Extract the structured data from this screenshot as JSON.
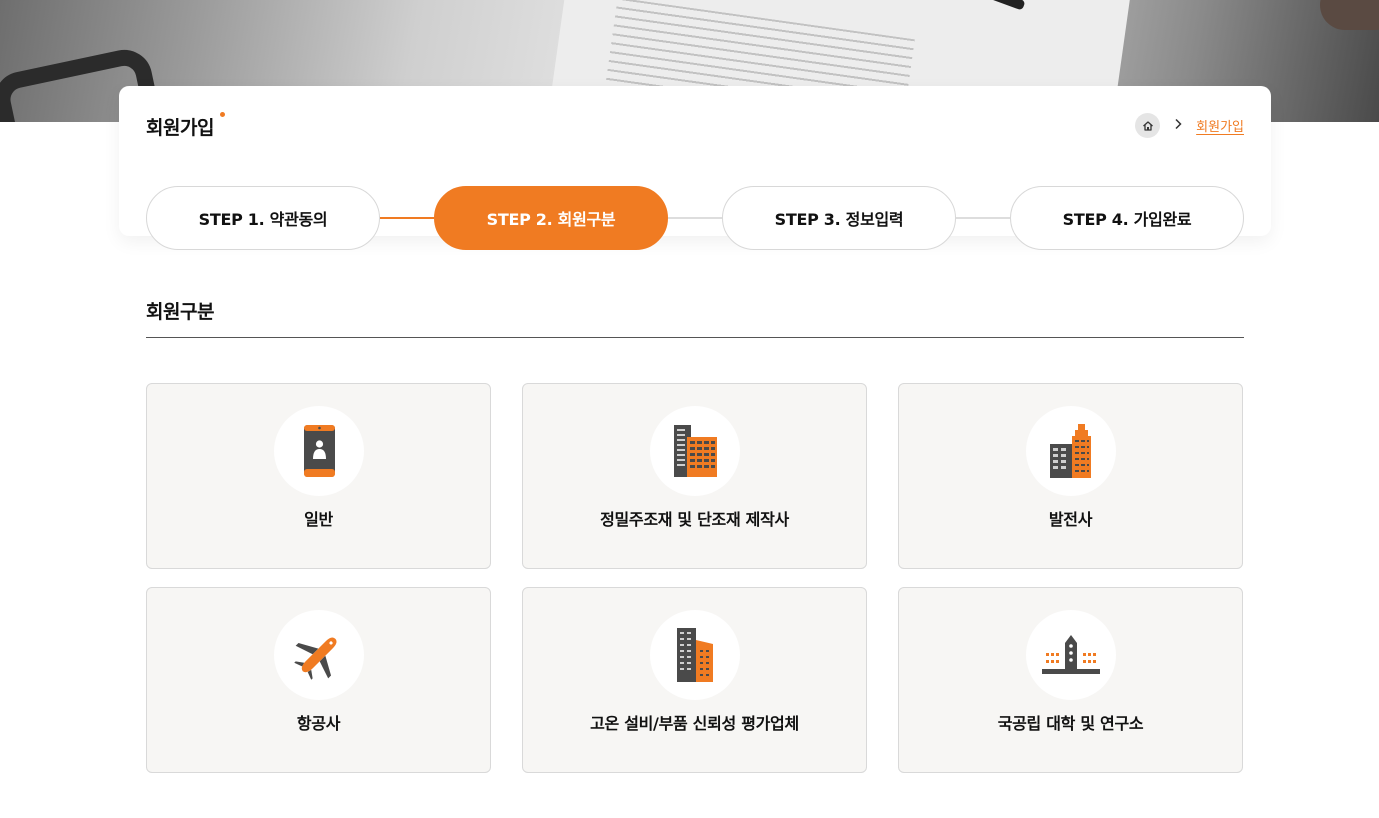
{
  "page": {
    "title": "회원가입",
    "accent_color": "#f07b22"
  },
  "breadcrumb": {
    "home_icon": "home-icon",
    "separator_icon": "chevron-right-icon",
    "current": "회원가입"
  },
  "steps": [
    {
      "label": "STEP 1. 약관동의",
      "state": "done"
    },
    {
      "label": "STEP 2. 회원구분",
      "state": "active"
    },
    {
      "label": "STEP 3. 정보입력",
      "state": "pending"
    },
    {
      "label": "STEP 4. 가입완료",
      "state": "pending"
    }
  ],
  "section": {
    "title": "회원구분"
  },
  "member_types": [
    {
      "label": "일반",
      "icon": "smartphone-user-icon"
    },
    {
      "label": "정밀주조재 및 단조재 제작사",
      "icon": "buildings-icon"
    },
    {
      "label": "발전사",
      "icon": "power-plant-buildings-icon"
    },
    {
      "label": "항공사",
      "icon": "airplane-icon"
    },
    {
      "label": "고온 설비/부품 신뢰성 평가업체",
      "icon": "office-buildings-icon"
    },
    {
      "label": "국공립 대학 및 연구소",
      "icon": "research-institute-icon"
    }
  ]
}
